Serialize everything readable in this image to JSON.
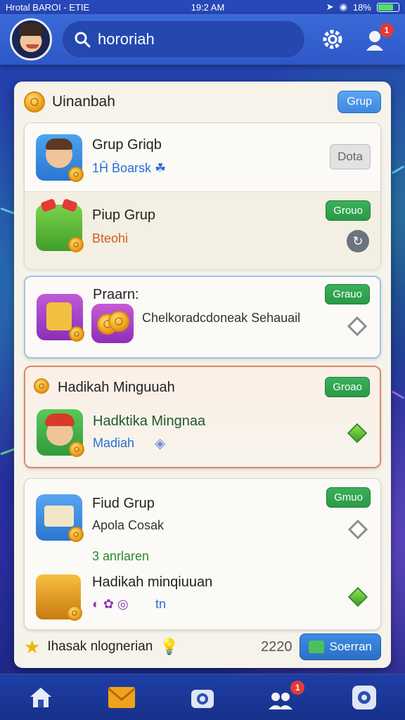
{
  "status_bar": {
    "carrier": "Hrotal BAROI - ETIE",
    "time": "19:2 AM",
    "battery": "18%"
  },
  "header": {
    "search_value": "hororiah",
    "notification_count": "1"
  },
  "panel": {
    "title": "Uinanbah",
    "title_button": "Grup",
    "cards": [
      {
        "rows": [
          {
            "title": "Grup Griqb",
            "subtitle": "1Ĥ Ḃoarsk ☘",
            "action": "Dota"
          },
          {
            "title": "Piup Grup",
            "subtitle": "Bteohi",
            "action": "Grouo"
          }
        ]
      },
      {
        "rows": [
          {
            "title": "Praarn:",
            "subtitle": "Chelkoradcdoneak Sehauail",
            "action": "Grauo"
          }
        ]
      },
      {
        "rows": [
          {
            "header": "Hadikah Minguuah",
            "action": "Groao"
          },
          {
            "title": "Hadktika Mingnaa",
            "subtitle": "Madiah"
          }
        ]
      },
      {
        "rows": [
          {
            "title": "Fiud Grup",
            "subtitle": "Apola Cosak",
            "action": "Gmuo"
          },
          {
            "extra": "3 anrlaren"
          },
          {
            "title": "Hadikah minqiuuan",
            "subtitle": "tn"
          }
        ]
      }
    ],
    "footer": {
      "label": "Ihasak nlognerian",
      "value": "2220",
      "button": "Soerran"
    }
  },
  "colors": {
    "accent_blue": "#3e88e0",
    "accent_green": "#2a9a46",
    "badge_red": "#e53935",
    "header_blue": "#2e58c8"
  }
}
